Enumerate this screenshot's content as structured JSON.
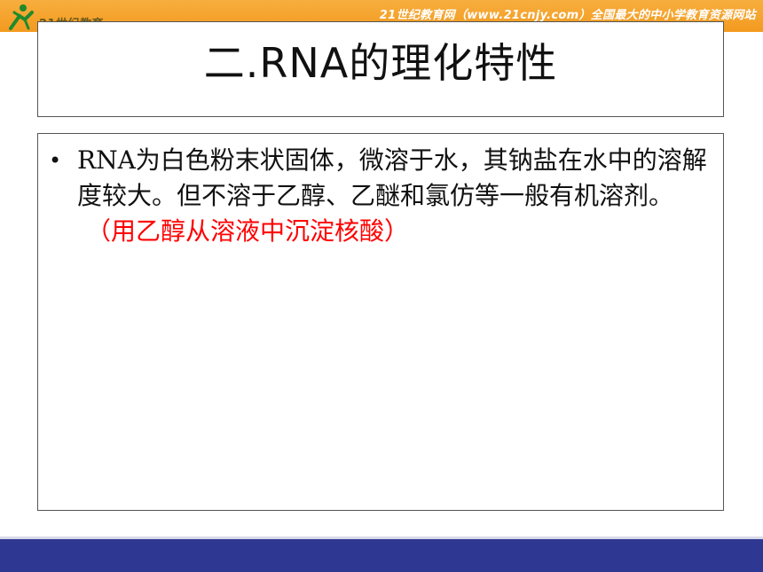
{
  "header": {
    "logo_text": "21世纪教育",
    "slogan": "21世纪教育网（www.21cnjy.com）全国最大的中小学教育资源网站",
    "colors": {
      "band": "#f39a1f",
      "logo_green": "#1f8a2c"
    },
    "logo_icon": "running-figure-icon"
  },
  "slide": {
    "title": "二.RNA的理化特性",
    "bullet": {
      "marker": "•",
      "text": "RNA为白色粉末状固体，微溶于水，其钠盐在水中的溶解度较大。但不溶于乙醇、乙醚和氯仿等一般有机溶剂。",
      "note": "（用乙醇从溶液中沉淀核酸）",
      "note_color": "#ff0000"
    }
  },
  "footer": {
    "color": "#2e3892"
  }
}
